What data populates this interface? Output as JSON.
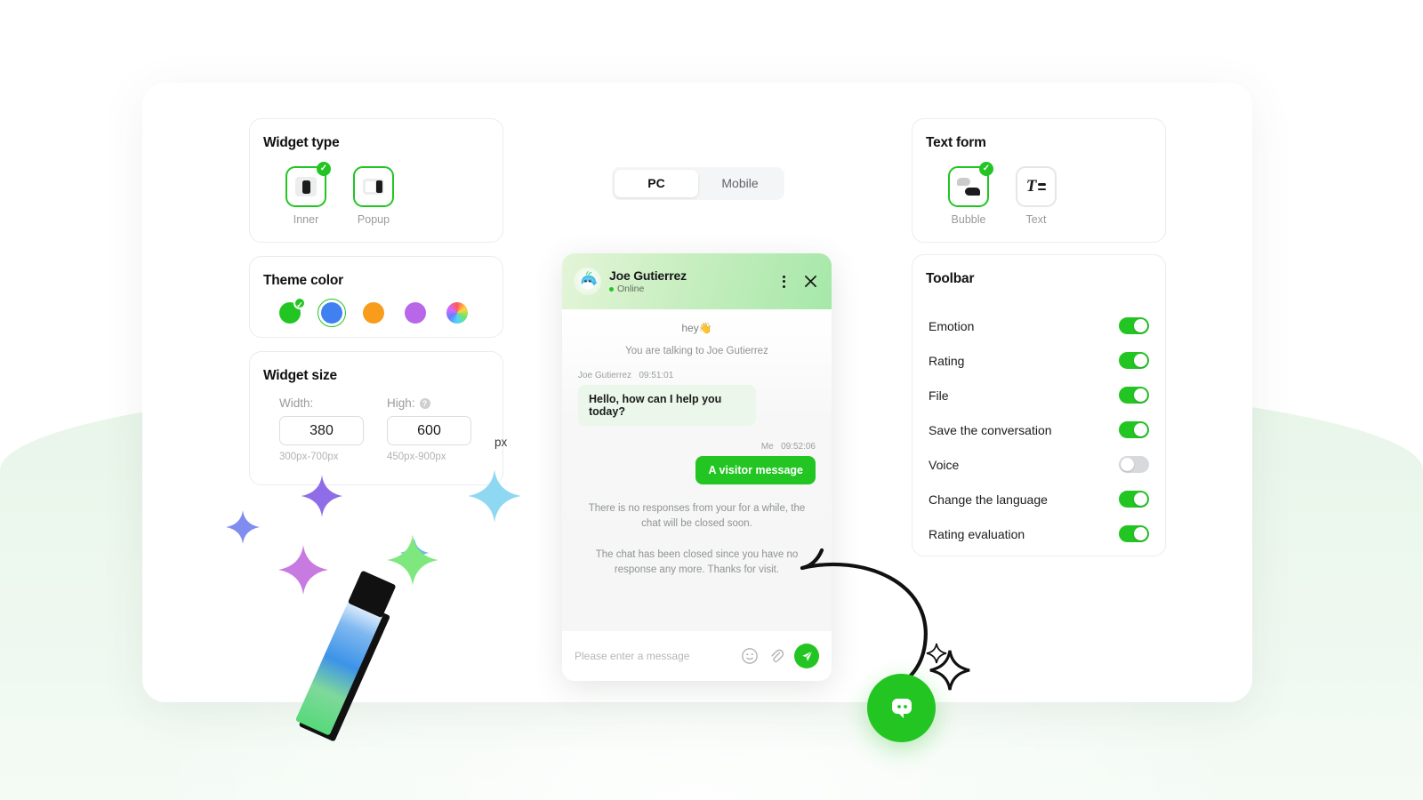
{
  "widget_type": {
    "title": "Widget type",
    "options": [
      {
        "label": "Inner",
        "icon": "inner-widget-icon",
        "selected": true
      },
      {
        "label": "Popup",
        "icon": "popup-widget-icon",
        "selected": false
      }
    ]
  },
  "theme_color": {
    "title": "Theme color",
    "selected_index": 1,
    "checked_index": 0,
    "swatches": [
      {
        "name": "green",
        "hex": "#22c522"
      },
      {
        "name": "blue",
        "hex": "#4080f0"
      },
      {
        "name": "orange",
        "hex": "#f89c1c"
      },
      {
        "name": "purple",
        "hex": "#b867e8"
      },
      {
        "name": "rainbow",
        "hex": "rainbow"
      }
    ]
  },
  "widget_size": {
    "title": "Widget size",
    "width_label": "Width:",
    "height_label": "High:",
    "help_icon": "question-mark-icon",
    "width_value": "380",
    "height_value": "600",
    "unit": "px",
    "width_hint": "300px-700px",
    "height_hint": "450px-900px"
  },
  "preview_tabs": {
    "items": [
      {
        "label": "PC",
        "active": true
      },
      {
        "label": "Mobile",
        "active": false
      }
    ]
  },
  "text_form": {
    "title": "Text form",
    "options": [
      {
        "label": "Bubble",
        "icon": "bubble-form-icon",
        "selected": true
      },
      {
        "label": "Text",
        "icon": "text-form-icon",
        "selected": false
      }
    ]
  },
  "toolbar": {
    "title": "Toolbar",
    "items": [
      {
        "label": "Emotion",
        "on": true
      },
      {
        "label": "Rating",
        "on": true
      },
      {
        "label": "File",
        "on": true
      },
      {
        "label": "Save the conversation",
        "on": true
      },
      {
        "label": "Voice",
        "on": false
      },
      {
        "label": "Change the language",
        "on": true
      },
      {
        "label": "Rating evaluation",
        "on": true
      }
    ]
  },
  "chat": {
    "agent_name": "Joe Gutierrez",
    "status": "Online",
    "avatar_icon": "whale-avatar",
    "menu_icon": "kebab-menu-icon",
    "close_icon": "close-icon",
    "greeting": "hey👋",
    "intro": "You are talking to Joe Gutierrez",
    "messages": [
      {
        "sender": "Joe Gutierrez",
        "time": "09:51:01",
        "text": "Hello, how can I help you today?",
        "side": "in"
      },
      {
        "sender": "Me",
        "time": "09:52:06",
        "text": "A visitor message",
        "side": "out"
      }
    ],
    "system_notes": [
      "There is no responses from your for a while, the chat will be closed soon.",
      "The chat has been closed since you have no response any more. Thanks for visit."
    ],
    "input_placeholder": "Please enter a message",
    "emoji_icon": "smiley-icon",
    "attach_icon": "paperclip-icon",
    "send_icon": "send-icon"
  },
  "fab": {
    "icon": "chat-bubble-icon"
  },
  "decorations": {
    "marker": "highlighter-marker-illustration",
    "arrow": "curved-arrow",
    "sparkles": "four-point-star-sparkles"
  }
}
